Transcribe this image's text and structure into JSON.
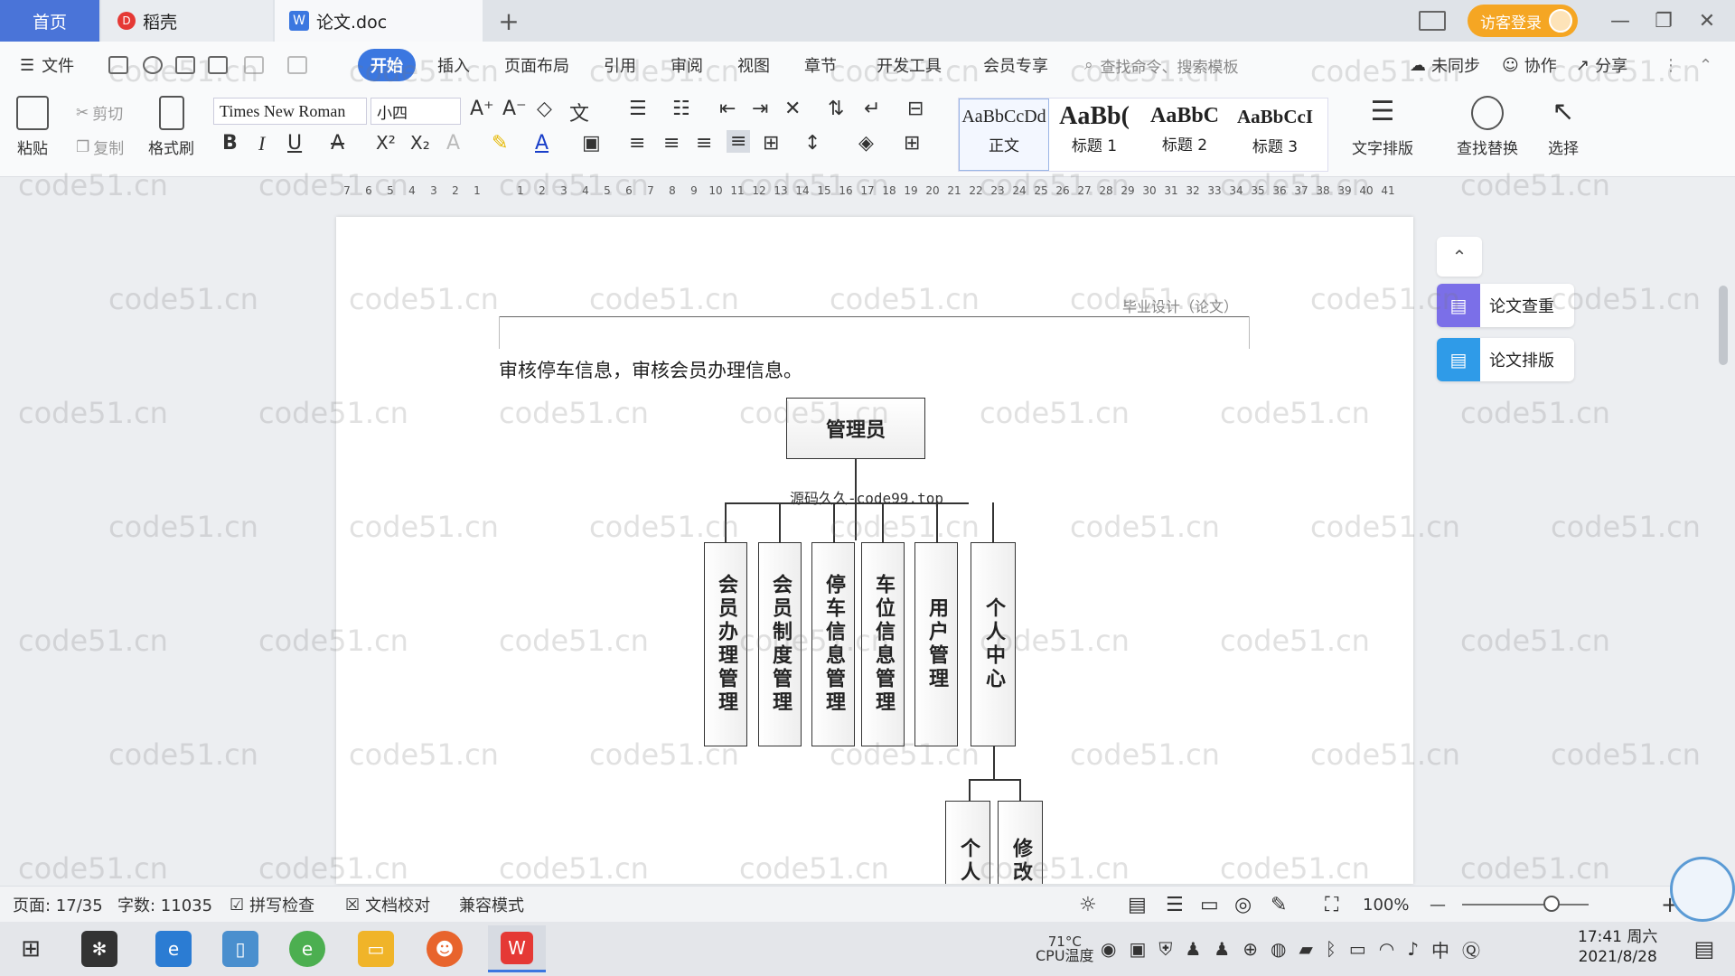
{
  "tabs": {
    "home": "首页",
    "daoke": "稻壳",
    "doc": "论文.doc",
    "daoke_logo": "D",
    "doc_logo": "W",
    "plus": "+"
  },
  "window": {
    "visitor_login": "访客登录",
    "minimize": "—",
    "restore": "❐",
    "close": "✕"
  },
  "menu": {
    "file": "文件",
    "start": "开始",
    "insert": "插入",
    "layout": "页面布局",
    "reference": "引用",
    "review": "审阅",
    "view": "视图",
    "chapter": "章节",
    "dev_tools": "开发工具",
    "member": "会员专享",
    "search_placeholder": "查找命令、搜索模板",
    "sync": "未同步",
    "collab": "协作",
    "share": "分享"
  },
  "toolbar": {
    "paste": "粘贴",
    "cut": "剪切",
    "copy": "复制",
    "format_painter": "格式刷",
    "font": "Times New Roman",
    "size": "小四",
    "text_layout": "文字排版",
    "find_replace": "查找替换",
    "select": "选择",
    "bold": "B",
    "italic": "I",
    "underline": "U",
    "superscript": "X²",
    "subscript": "X₂"
  },
  "styles": [
    {
      "sample": "AaBbCcDd",
      "name": "正文"
    },
    {
      "sample": "AaBb(",
      "name": "标题 1"
    },
    {
      "sample": "AaBbC",
      "name": "标题 2"
    },
    {
      "sample": "AaBbCcI",
      "name": "标题 3"
    }
  ],
  "ruler": [
    "7",
    "6",
    "5",
    "4",
    "3",
    "2",
    "1",
    "",
    "1",
    "2",
    "3",
    "4",
    "5",
    "6",
    "7",
    "8",
    "9",
    "10",
    "11",
    "12",
    "13",
    "14",
    "15",
    "16",
    "17",
    "18",
    "19",
    "20",
    "21",
    "22",
    "23",
    "24",
    "25",
    "26",
    "27",
    "28",
    "29",
    "30",
    "31",
    "32",
    "33",
    "34",
    "35",
    "36",
    "37",
    "38",
    "39",
    "40",
    "41"
  ],
  "document": {
    "header": "毕业设计（论文）",
    "paragraph": "审核停车信息，审核会员办理信息。",
    "diagram": {
      "root": "管理员",
      "source_watermark": "源码久久-code99.top",
      "children": [
        "会员办理管理",
        "会员制度管理",
        "停车信息管理",
        "车位信息管理",
        "用户管理",
        "个人中心"
      ],
      "grandchildren": [
        "个人",
        "修改"
      ]
    }
  },
  "side_panel": {
    "collapse": "⌃",
    "plagiarism_check": "论文查重",
    "thesis_format": "论文排版"
  },
  "watermark_text": "code51.cn",
  "status": {
    "page": "页面: 17/35",
    "words": "字数: 11035",
    "spell_check": "拼写检查",
    "doc_proof": "文档校对",
    "compat_mode": "兼容模式",
    "zoom": "100%",
    "zoom_minus": "—",
    "zoom_plus": "+"
  },
  "taskbar": {
    "cpu_temp": "71°C",
    "cpu_label": "CPU温度",
    "ime": "中",
    "time": "17:41 周六",
    "date": "2021/8/28"
  }
}
